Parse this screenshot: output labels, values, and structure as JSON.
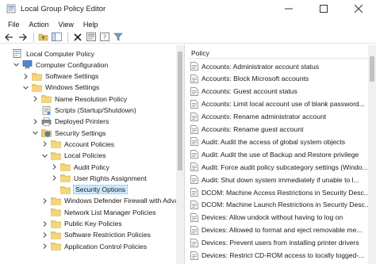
{
  "window": {
    "title": "Local Group Policy Editor"
  },
  "menu": [
    "File",
    "Action",
    "View",
    "Help"
  ],
  "toolbar": [
    "back-icon",
    "forward-icon",
    "up-folder-icon",
    "show-hide-tree-icon",
    "delete-icon",
    "properties-icon",
    "help-icon",
    "filter-icon"
  ],
  "tree": [
    {
      "label": "Local Computer Policy",
      "level": 0,
      "expand": "none",
      "icon": "computer-policy-icon"
    },
    {
      "label": "Computer Configuration",
      "level": 1,
      "expand": "open",
      "icon": "computer-icon"
    },
    {
      "label": "Software Settings",
      "level": 2,
      "expand": "closed",
      "icon": "folder-icon"
    },
    {
      "label": "Windows Settings",
      "level": 2,
      "expand": "open",
      "icon": "folder-icon"
    },
    {
      "label": "Name Resolution Policy",
      "level": 3,
      "expand": "closed",
      "icon": "folder-icon"
    },
    {
      "label": "Scripts (Startup/Shutdown)",
      "level": 3,
      "expand": "none",
      "icon": "script-icon"
    },
    {
      "label": "Deployed Printers",
      "level": 3,
      "expand": "closed",
      "icon": "printer-icon"
    },
    {
      "label": "Security Settings",
      "level": 3,
      "expand": "open",
      "icon": "security-icon"
    },
    {
      "label": "Account Policies",
      "level": 4,
      "expand": "closed",
      "icon": "folder-icon"
    },
    {
      "label": "Local Policies",
      "level": 4,
      "expand": "open",
      "icon": "folder-icon"
    },
    {
      "label": "Audit Policy",
      "level": 5,
      "expand": "closed",
      "icon": "folder-icon"
    },
    {
      "label": "User Rights Assignment",
      "level": 5,
      "expand": "closed",
      "icon": "folder-icon"
    },
    {
      "label": "Security Options",
      "level": 5,
      "expand": "none",
      "icon": "folder-icon",
      "selected": true
    },
    {
      "label": "Windows Defender Firewall with Advanc",
      "level": 4,
      "expand": "closed",
      "icon": "folder-icon"
    },
    {
      "label": "Network List Manager Policies",
      "level": 4,
      "expand": "none",
      "icon": "folder-icon"
    },
    {
      "label": "Public Key Policies",
      "level": 4,
      "expand": "closed",
      "icon": "folder-icon"
    },
    {
      "label": "Software Restriction Policies",
      "level": 4,
      "expand": "closed",
      "icon": "folder-icon"
    },
    {
      "label": "Application Control Policies",
      "level": 4,
      "expand": "closed",
      "icon": "folder-icon"
    }
  ],
  "policy_list": {
    "header": "Policy",
    "items": [
      "Accounts: Administrator account status",
      "Accounts: Block Microsoft accounts",
      "Accounts: Guest account status",
      "Accounts: Limit local account use of blank password...",
      "Accounts: Rename administrator account",
      "Accounts: Rename guest account",
      "Audit: Audit the access of global system objects",
      "Audit: Audit the use of Backup and Restore privilege",
      "Audit: Force audit policy subcategory settings (Windo...",
      "Audit: Shut down system immediately if unable to l...",
      "DCOM: Machine Access Restrictions in Security Desc...",
      "DCOM: Machine Launch Restrictions in Security Desc...",
      "Devices: Allow undock without having to log on",
      "Devices: Allowed to format and eject removable me...",
      "Devices: Prevent users from installing printer drivers",
      "Devices: Restrict CD-ROM access to locally logged-..."
    ]
  }
}
